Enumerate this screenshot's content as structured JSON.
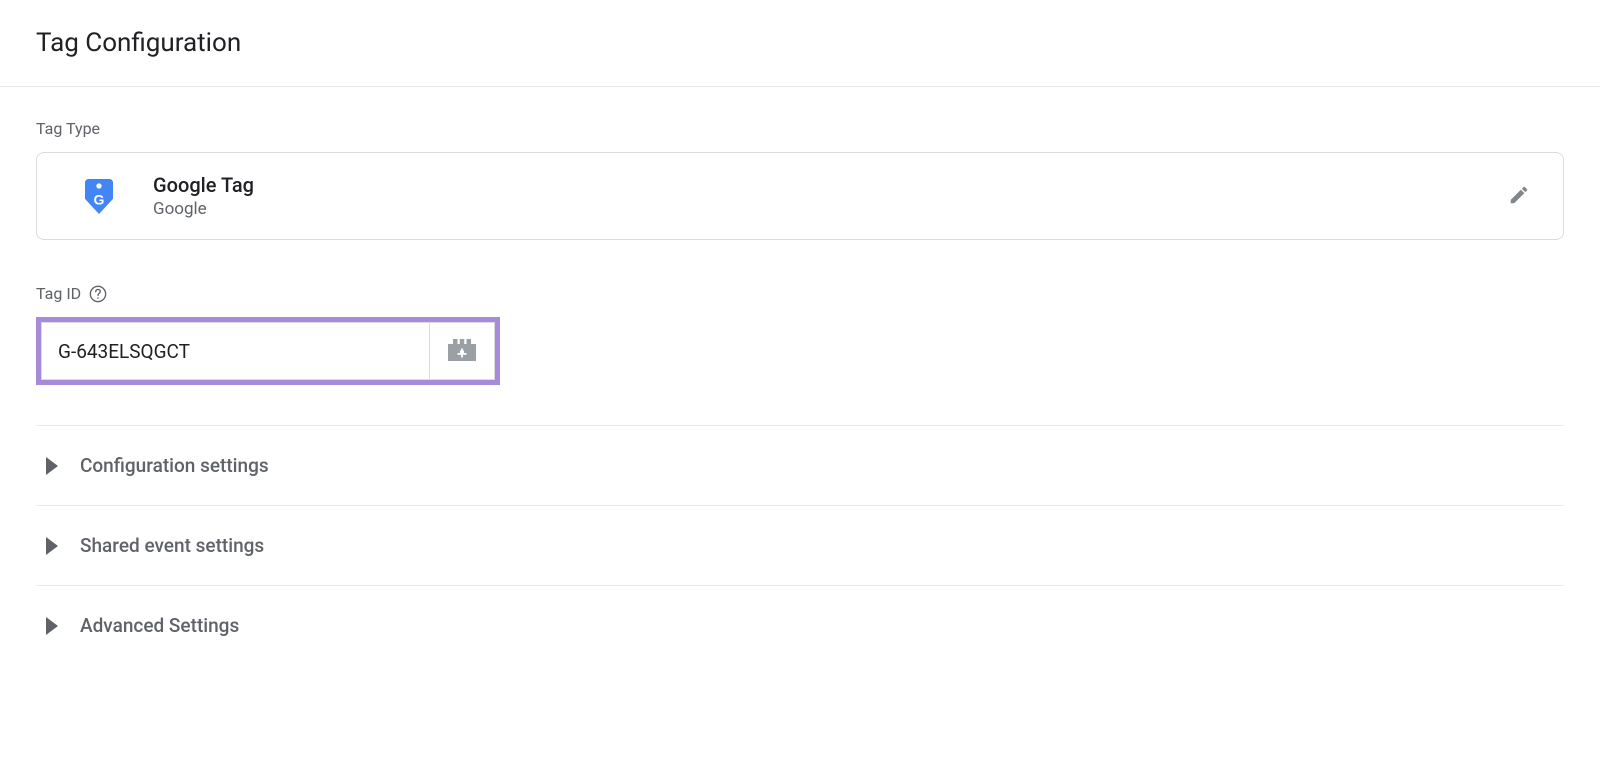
{
  "header": {
    "title": "Tag Configuration"
  },
  "tagType": {
    "label": "Tag Type",
    "name": "Google Tag",
    "vendor": "Google"
  },
  "tagId": {
    "label": "Tag ID",
    "value": "G-643ELSQGCT"
  },
  "sections": [
    {
      "label": "Configuration settings"
    },
    {
      "label": "Shared event settings"
    },
    {
      "label": "Advanced Settings"
    }
  ]
}
